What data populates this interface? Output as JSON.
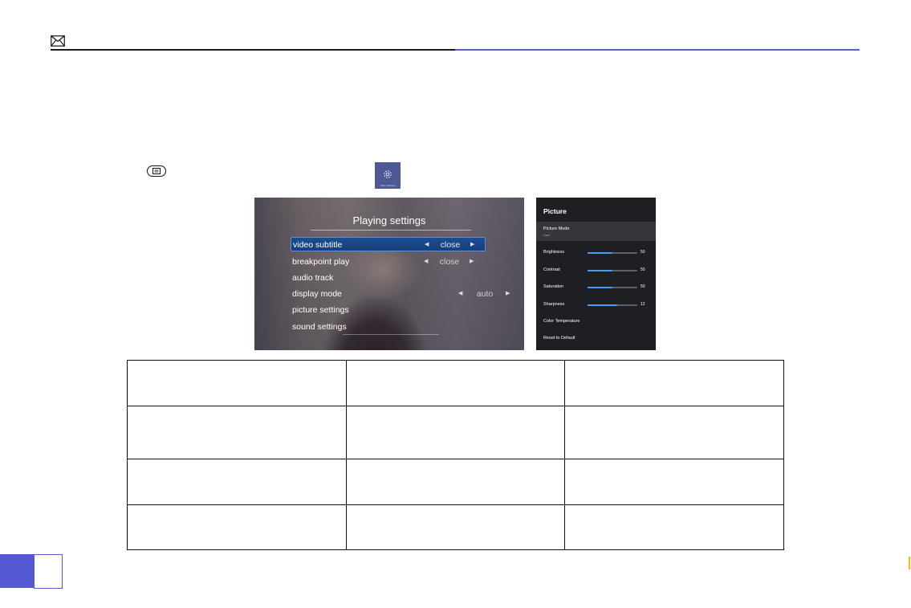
{
  "header": {
    "mail_icon": "envelope-icon",
    "rule_accent_color": "#5a5fd6"
  },
  "instruction": {
    "menu_key_icon": "menu-key-icon",
    "settings_tile_icon": "gear-icon",
    "settings_tile_label": "Other Settings"
  },
  "playing_settings": {
    "title": "Playing settings",
    "rows": [
      {
        "label": "video subtitle",
        "value": "close",
        "selected": true
      },
      {
        "label": "breakpoint play",
        "value": "close"
      },
      {
        "label": "audio track",
        "value": ""
      },
      {
        "label": "display mode",
        "value": "auto"
      },
      {
        "label": "picture settings",
        "value": ""
      },
      {
        "label": "sound settings",
        "value": ""
      }
    ],
    "selection_color": "#1b4f93"
  },
  "picture_panel": {
    "title": "Picture",
    "mode_label": "Picture Mode",
    "mode_value": "User",
    "sliders": [
      {
        "label": "Brightness",
        "value": "50",
        "level": 0.5
      },
      {
        "label": "Contrast",
        "value": "50",
        "level": 0.5
      },
      {
        "label": "Saturation",
        "value": "50",
        "level": 0.5
      },
      {
        "label": "Sharpness",
        "value": "12",
        "level": 0.6
      }
    ],
    "links": [
      "Color Temperature",
      "Reset to Default"
    ],
    "accent_color": "#4a9df2"
  },
  "table": {
    "rows": [
      [
        "",
        "",
        ""
      ],
      [
        "",
        "",
        ""
      ],
      [
        "",
        "",
        ""
      ],
      [
        "",
        "",
        ""
      ]
    ]
  },
  "page_tab_color": "#5558d2"
}
